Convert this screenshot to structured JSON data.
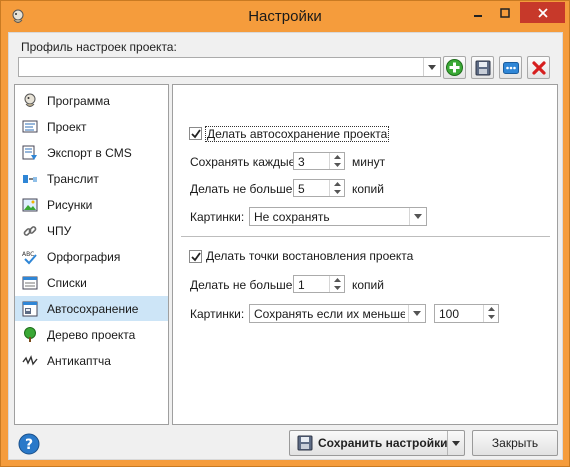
{
  "window": {
    "title": "Настройки",
    "accent": "#f59c3c",
    "close_color": "#c7392a"
  },
  "profile": {
    "label": "Профиль настроек проекта:",
    "value": ""
  },
  "sidebar": {
    "items": [
      {
        "label": "Программа",
        "icon": "program-icon"
      },
      {
        "label": "Проект",
        "icon": "project-icon"
      },
      {
        "label": "Экспорт в CMS",
        "icon": "export-icon"
      },
      {
        "label": "Транслит",
        "icon": "translit-icon"
      },
      {
        "label": "Рисунки",
        "icon": "images-icon"
      },
      {
        "label": "ЧПУ",
        "icon": "link-icon"
      },
      {
        "label": "Орфография",
        "icon": "spellcheck-icon"
      },
      {
        "label": "Списки",
        "icon": "list-icon"
      },
      {
        "label": "Автосохранение",
        "icon": "autosave-icon"
      },
      {
        "label": "Дерево проекта",
        "icon": "tree-icon"
      },
      {
        "label": "Антикаптча",
        "icon": "captcha-icon"
      }
    ],
    "selected": "Автосохранение"
  },
  "autosave": {
    "enable_label": "Делать автосохранение проекта",
    "enable_checked": true,
    "every_label": "Сохранять каждые",
    "every_value": "3",
    "every_unit": "минут",
    "max_label": "Делать не больше",
    "max_value": "5",
    "max_unit": "копий",
    "images_label": "Картинки:",
    "images_value": "Не сохранять"
  },
  "restore": {
    "enable_label": "Делать точки востановления проекта",
    "enable_checked": true,
    "max_label": "Делать не больше",
    "max_value": "1",
    "max_unit": "копий",
    "images_label": "Картинки:",
    "images_value": "Сохранять если их меньше...",
    "images_limit": "100"
  },
  "footer": {
    "save_label": "Сохранить настройки",
    "close_label": "Закрыть"
  }
}
